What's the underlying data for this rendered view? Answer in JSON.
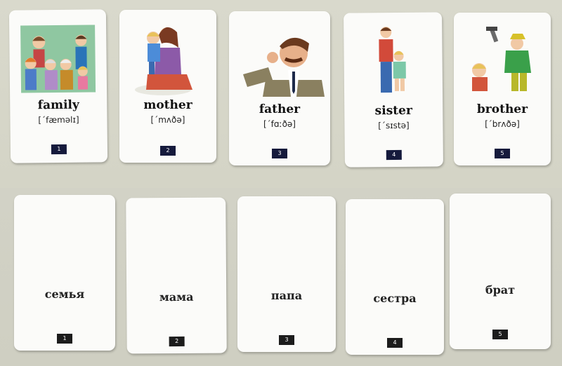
{
  "top_cards": [
    {
      "word": "family",
      "transcription": "[ˊfæməlɪ]",
      "number": "1",
      "picture": "family-group-illustration"
    },
    {
      "word": "mother",
      "transcription": "[ˊmʌðə]",
      "number": "2",
      "picture": "mother-holding-child-illustration"
    },
    {
      "word": "father",
      "transcription": "[ˊfɑːðə]",
      "number": "3",
      "picture": "father-with-moustache-illustration"
    },
    {
      "word": "sister",
      "transcription": "[ˊsɪstə]",
      "number": "4",
      "picture": "sisters-illustration"
    },
    {
      "word": "brother",
      "transcription": "[ˊbrʌðə]",
      "number": "5",
      "picture": "brothers-hammering-illustration"
    }
  ],
  "bottom_cards": [
    {
      "word": "семья",
      "number": "1"
    },
    {
      "word": "мама",
      "number": "2"
    },
    {
      "word": "папа",
      "number": "3"
    },
    {
      "word": "сестра",
      "number": "4"
    },
    {
      "word": "брат",
      "number": "5"
    }
  ],
  "colors": {
    "number_badge_top": "#151a3c",
    "number_badge_bottom": "#1c1c1c",
    "card": "#fbfbf9",
    "background": "#d8d8cc"
  }
}
